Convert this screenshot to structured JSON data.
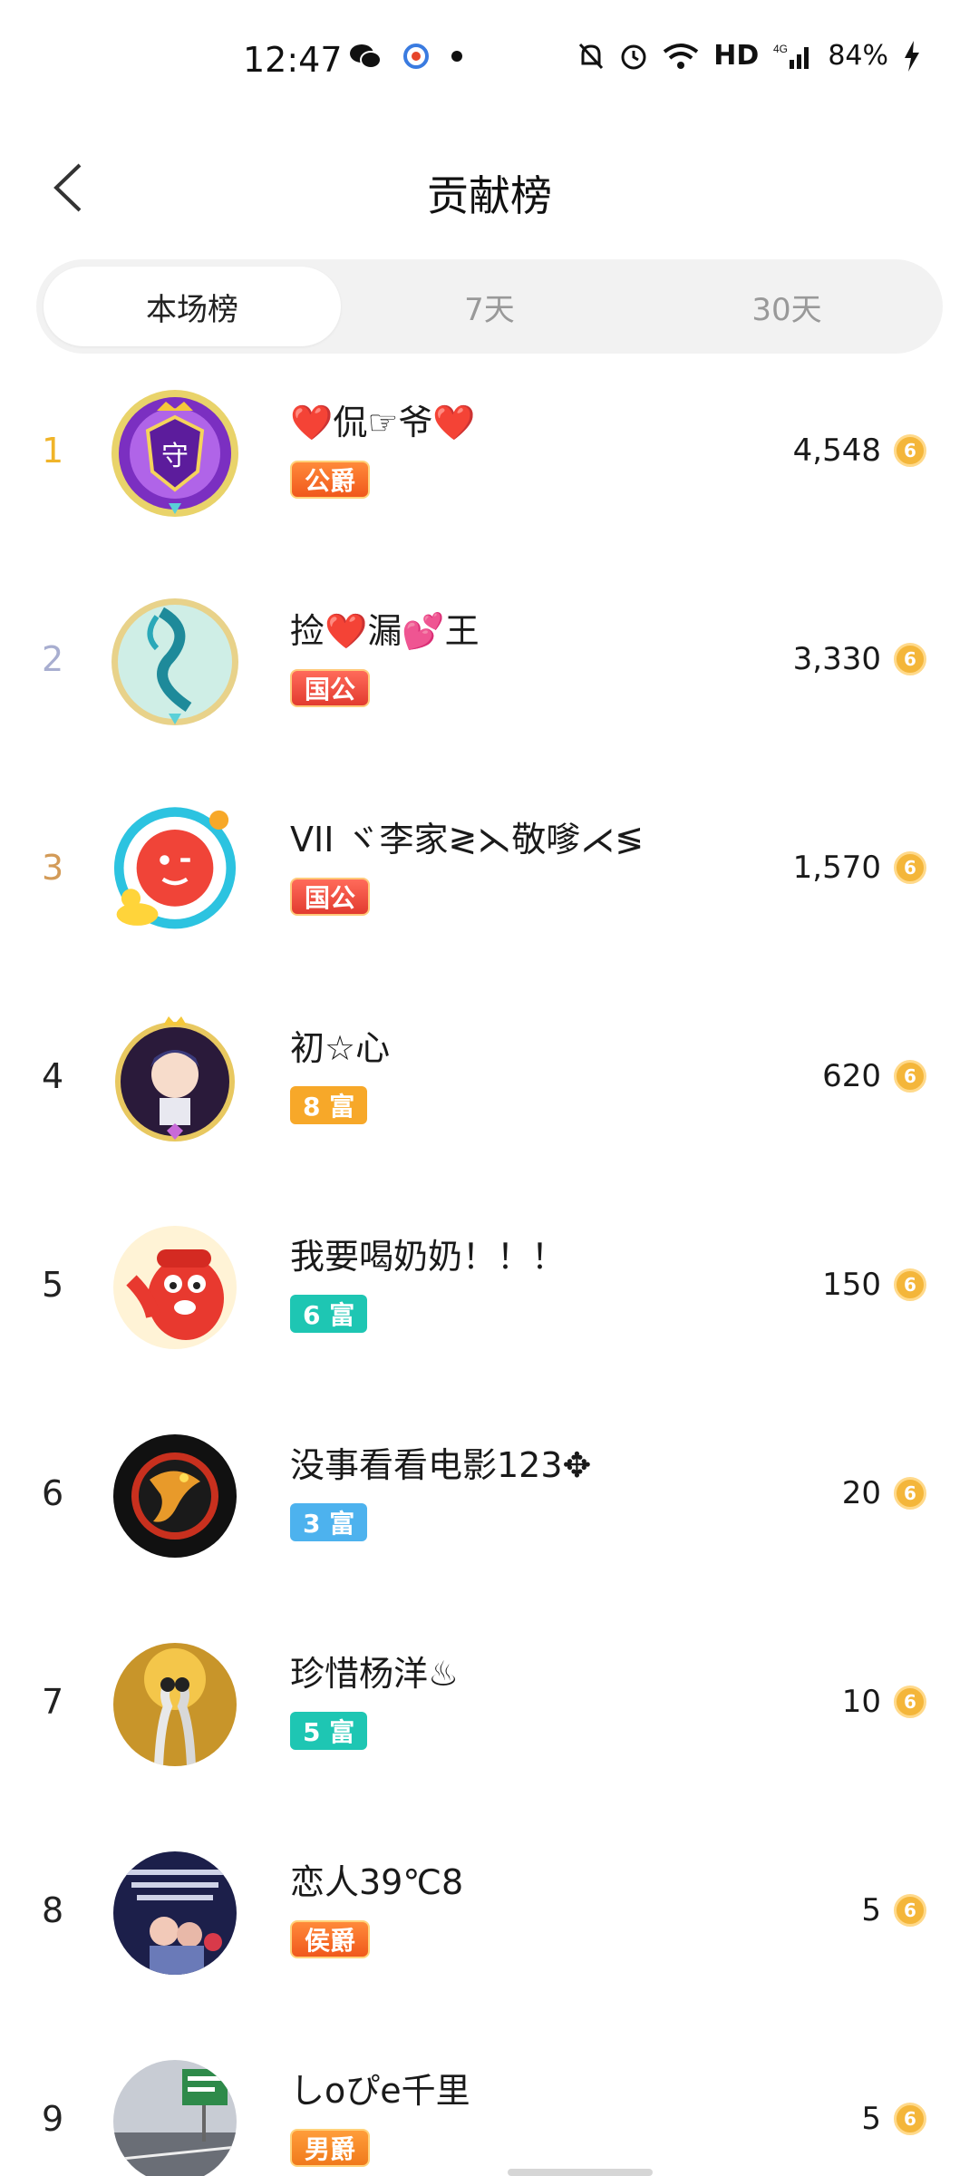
{
  "status_bar": {
    "time": "12:47",
    "battery": "84%",
    "network": "HD",
    "signal": "4G"
  },
  "header": {
    "title": "贡献榜"
  },
  "tabs": [
    {
      "label": "本场榜",
      "active": true
    },
    {
      "label": "7天",
      "active": false
    },
    {
      "label": "30天",
      "active": false
    }
  ],
  "rows": [
    {
      "rank": "1",
      "name": "❤️侃☞爷❤️",
      "badge": "公爵",
      "score": "4,548",
      "avatar": "purple-shield-frame"
    },
    {
      "rank": "2",
      "name": "捡❤️漏💕王",
      "badge": "国公",
      "score": "3,330",
      "avatar": "dragon-teal-frame"
    },
    {
      "rank": "3",
      "name": "VII ヾ李家≷⋋敬嗲⋌≶",
      "badge": "国公",
      "score": "1,570",
      "avatar": "red-emoji-pool-frame"
    },
    {
      "rank": "4",
      "name": "初☆心",
      "badge": "8 富",
      "score": "620",
      "avatar": "anime-boy-frame"
    },
    {
      "rank": "5",
      "name": "我要喝奶奶！！！",
      "badge": "6 富",
      "score": "150",
      "avatar": "red-mascot"
    },
    {
      "rank": "6",
      "name": "没事看看电影123✥",
      "badge": "3 富",
      "score": "20",
      "avatar": "dragon-logo"
    },
    {
      "rank": "7",
      "name": "珍惜杨洋♨",
      "badge": "5 富",
      "score": "10",
      "avatar": "cranes"
    },
    {
      "rank": "8",
      "name": "恋人39℃8",
      "badge": "侯爵",
      "score": "5",
      "avatar": "couple-text"
    },
    {
      "rank": "9",
      "name": "しoぴe千里",
      "badge": "男爵",
      "score": "5",
      "avatar": "highway-sign"
    }
  ],
  "coin_icon": "coin-icon",
  "colors": {
    "rank_gold": "#f0b429",
    "rank_silver": "#a8aed0",
    "rank_bronze": "#d39b58",
    "rich_orange": "#f7a829",
    "rich_teal": "#1ec6b3",
    "rich_blue": "#4db2ee"
  }
}
